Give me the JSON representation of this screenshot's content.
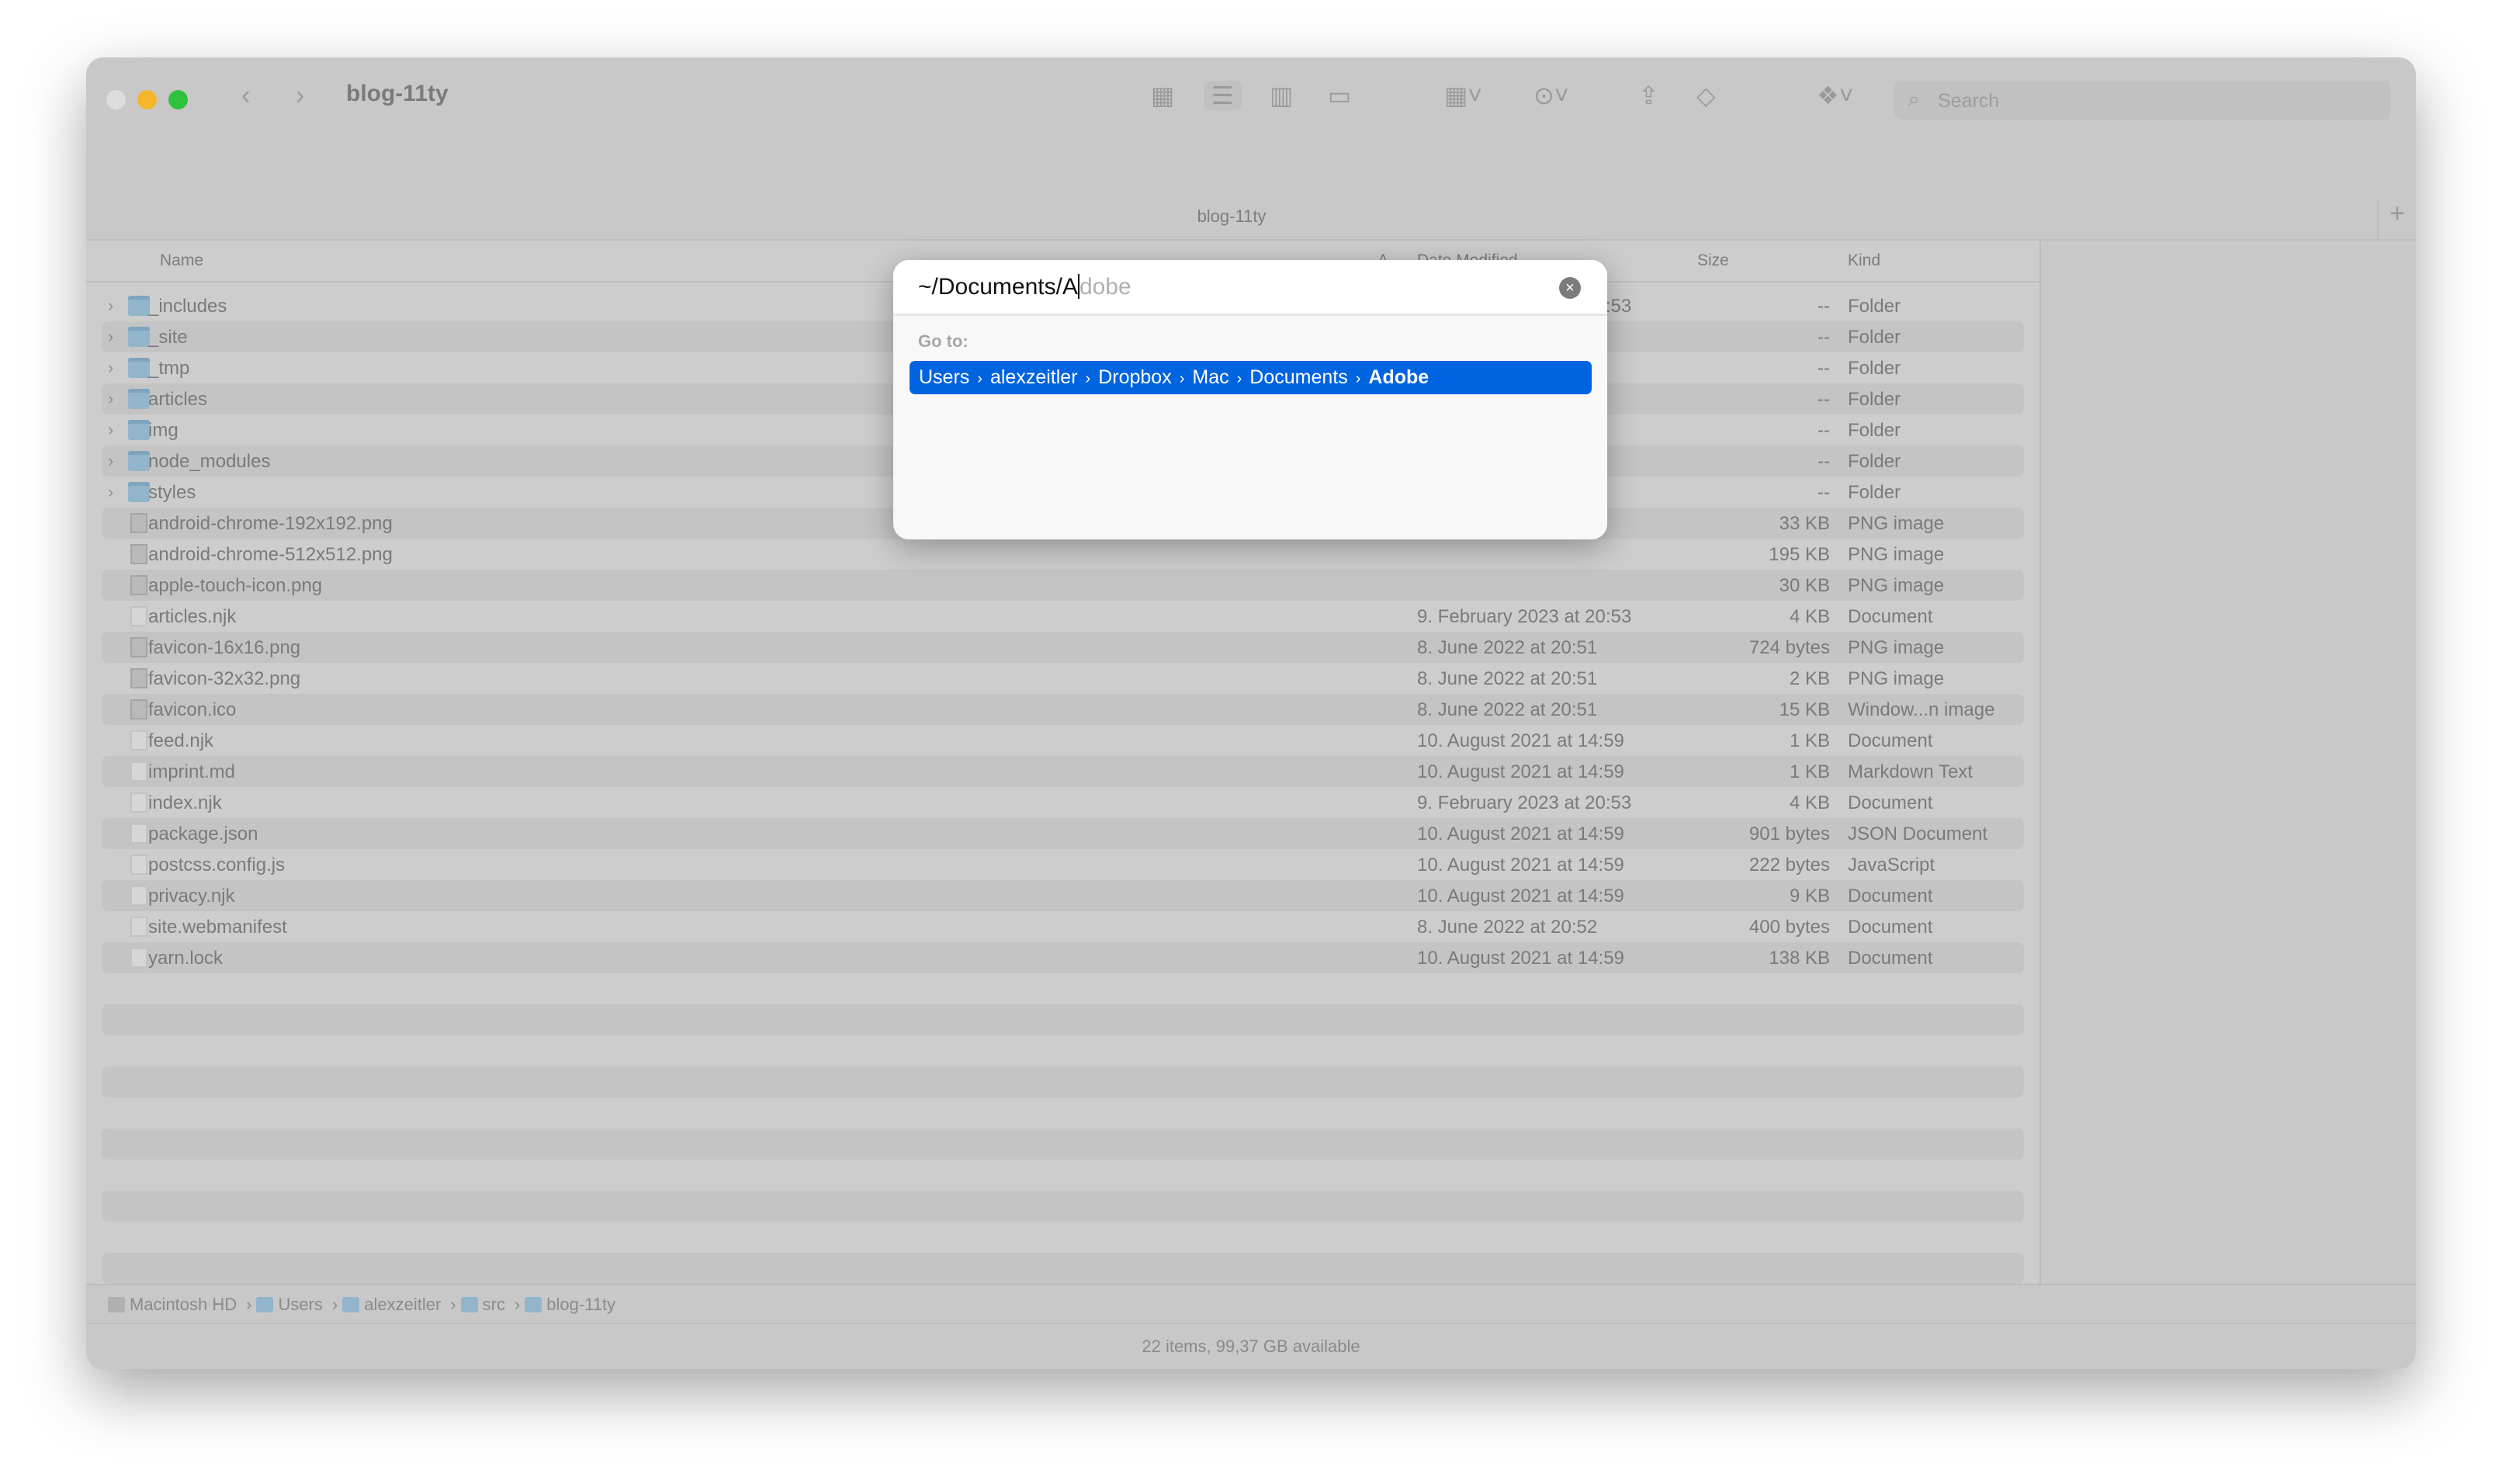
{
  "window": {
    "title": "blog-11ty",
    "tab_title": "blog-11ty",
    "search_placeholder": "Search",
    "traffic_light_colors": [
      "#dcdcdc",
      "#f5b62b",
      "#2ec33c"
    ]
  },
  "columns": {
    "name": "Name",
    "date": "Date Modified",
    "size": "Size",
    "kind": "Kind"
  },
  "rows": [
    {
      "name": "_includes",
      "date": "9. February 2023 at 20:53",
      "size": "--",
      "kind": "Folder",
      "icon": "folder"
    },
    {
      "name": "_site",
      "date": "",
      "size": "--",
      "kind": "Folder",
      "icon": "folder"
    },
    {
      "name": "_tmp",
      "date": "",
      "size": "--",
      "kind": "Folder",
      "icon": "folder"
    },
    {
      "name": "articles",
      "date": "",
      "size": "--",
      "kind": "Folder",
      "icon": "folder"
    },
    {
      "name": "img",
      "date": "",
      "size": "--",
      "kind": "Folder",
      "icon": "folder"
    },
    {
      "name": "node_modules",
      "date": "",
      "size": "--",
      "kind": "Folder",
      "icon": "folder"
    },
    {
      "name": "styles",
      "date": "",
      "size": "--",
      "kind": "Folder",
      "icon": "folder"
    },
    {
      "name": "android-chrome-192x192.png",
      "date": "",
      "size": "33 KB",
      "kind": "PNG image",
      "icon": "image"
    },
    {
      "name": "android-chrome-512x512.png",
      "date": "",
      "size": "195 KB",
      "kind": "PNG image",
      "icon": "image"
    },
    {
      "name": "apple-touch-icon.png",
      "date": "",
      "size": "30 KB",
      "kind": "PNG image",
      "icon": "image"
    },
    {
      "name": "articles.njk",
      "date": "9. February 2023 at 20:53",
      "size": "4 KB",
      "kind": "Document",
      "icon": "document"
    },
    {
      "name": "favicon-16x16.png",
      "date": "8. June 2022 at 20:51",
      "size": "724 bytes",
      "kind": "PNG image",
      "icon": "image"
    },
    {
      "name": "favicon-32x32.png",
      "date": "8. June 2022 at 20:51",
      "size": "2 KB",
      "kind": "PNG image",
      "icon": "image"
    },
    {
      "name": "favicon.ico",
      "date": "8. June 2022 at 20:51",
      "size": "15 KB",
      "kind": "Window...n image",
      "icon": "image"
    },
    {
      "name": "feed.njk",
      "date": "10. August 2021 at 14:59",
      "size": "1 KB",
      "kind": "Document",
      "icon": "document"
    },
    {
      "name": "imprint.md",
      "date": "10. August 2021 at 14:59",
      "size": "1 KB",
      "kind": "Markdown Text",
      "icon": "document"
    },
    {
      "name": "index.njk",
      "date": "9. February 2023 at 20:53",
      "size": "4 KB",
      "kind": "Document",
      "icon": "document"
    },
    {
      "name": "package.json",
      "date": "10. August 2021 at 14:59",
      "size": "901 bytes",
      "kind": "JSON Document",
      "icon": "document"
    },
    {
      "name": "postcss.config.js",
      "date": "10. August 2021 at 14:59",
      "size": "222 bytes",
      "kind": "JavaScript",
      "icon": "document"
    },
    {
      "name": "privacy.njk",
      "date": "10. August 2021 at 14:59",
      "size": "9 KB",
      "kind": "Document",
      "icon": "document"
    },
    {
      "name": "site.webmanifest",
      "date": "8. June 2022 at 20:52",
      "size": "400 bytes",
      "kind": "Document",
      "icon": "document"
    },
    {
      "name": "yarn.lock",
      "date": "10. August 2021 at 14:59",
      "size": "138 KB",
      "kind": "Document",
      "icon": "document"
    }
  ],
  "pathbar": [
    "Macintosh HD",
    "Users",
    "alexzeitler",
    "src",
    "blog-11ty"
  ],
  "status": "22 items, 99,37 GB available",
  "goto_dialog": {
    "typed": "~/Documents/A",
    "completion": "dobe",
    "label": "Go to:",
    "suggestion": [
      "Users",
      "alexzeitler",
      "Dropbox",
      "Mac",
      "Documents",
      "Adobe"
    ],
    "accent": "#0064e1"
  }
}
